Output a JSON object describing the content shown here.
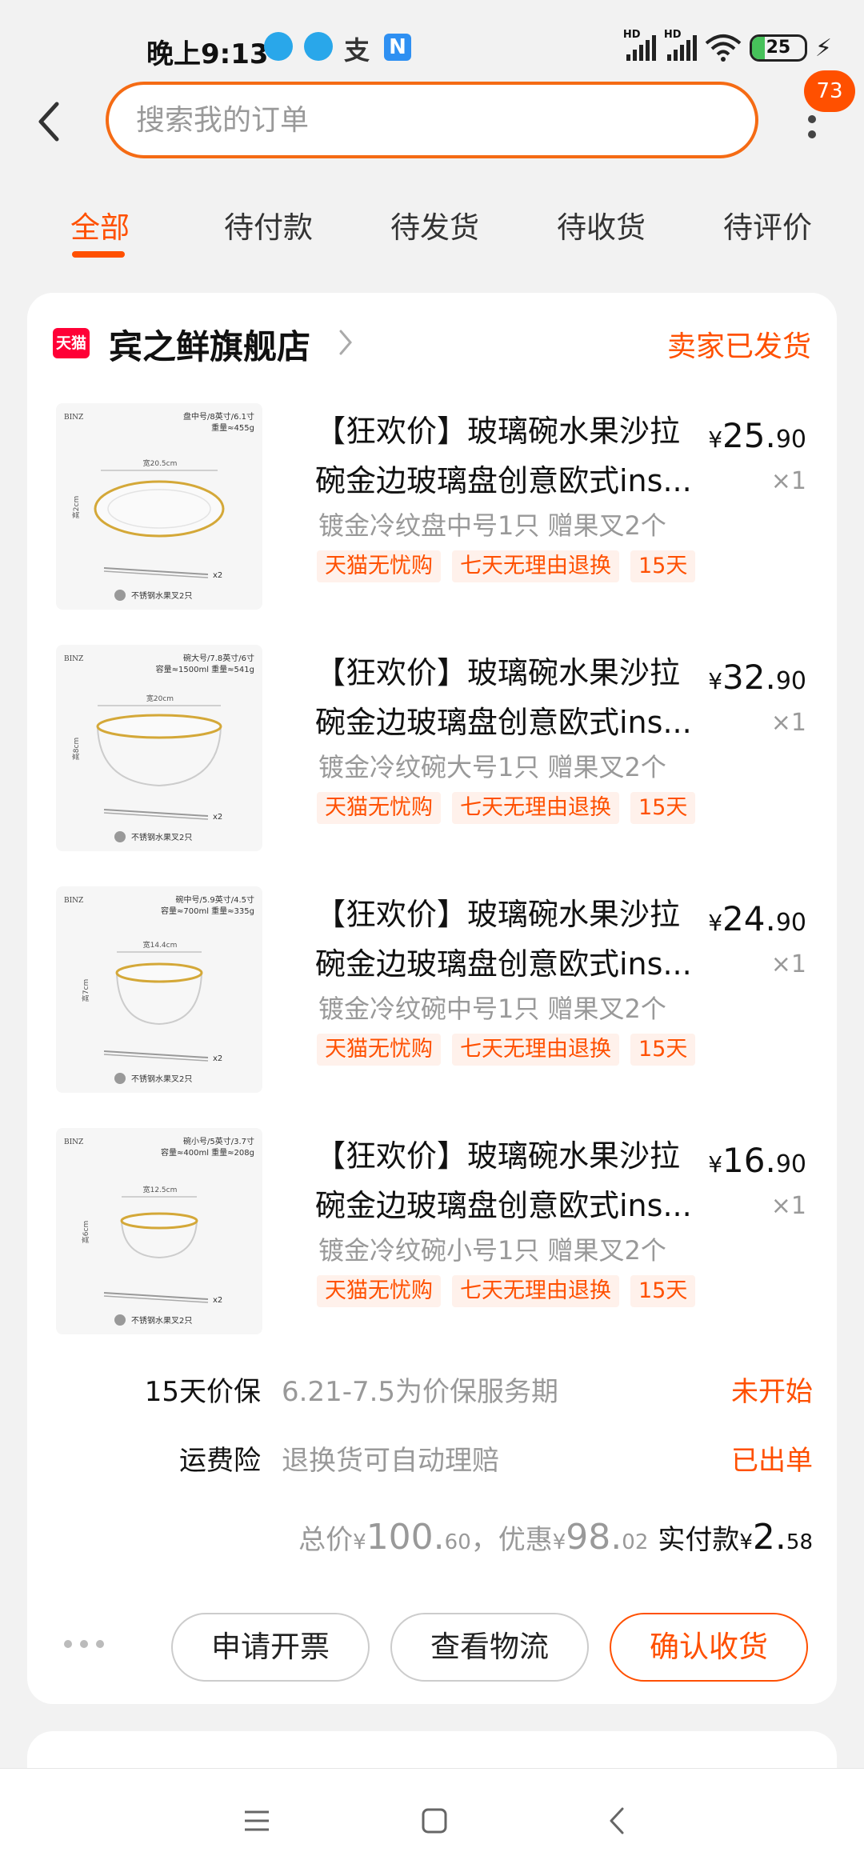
{
  "status_bar": {
    "time": "晚上9:13",
    "app_icons": [
      "qq-icon",
      "qq-icon",
      "alipay-icon",
      "n-app-icon"
    ],
    "zhi_glyph": "支",
    "n_glyph": "N",
    "signal_label": "HD",
    "battery_level": "25",
    "battery_fraction": 0.25
  },
  "header": {
    "search_placeholder": "搜索我的订单",
    "more_badge": "73"
  },
  "tabs": [
    {
      "label": "全部",
      "active": true
    },
    {
      "label": "待付款",
      "active": false
    },
    {
      "label": "待发货",
      "active": false
    },
    {
      "label": "待收货",
      "active": false
    },
    {
      "label": "待评价",
      "active": false
    }
  ],
  "order": {
    "shop_badge": "天猫",
    "shop_name": "宾之鲜旗舰店",
    "status": "卖家已发货",
    "items": [
      {
        "title_line1": "【狂欢价】玻璃碗水果沙拉",
        "title_line2": "碗金边玻璃盘创意欧式ins...",
        "sku": "镀金冷纹盘中号1只  赠果叉2个",
        "tags": [
          "天猫无忧购",
          "七天无理由退换",
          "15天"
        ],
        "price_currency": "¥",
        "price_int": "25.",
        "price_dec": "90",
        "qty": "×1",
        "thumb": {
          "brand": "BINZ",
          "size_line1": "盘中号/8英寸/6.1寸",
          "size_line2": "重量≈455g",
          "width": "宽20.5cm",
          "height": "高2cm",
          "fork": "x2",
          "caption": "不锈钢水果叉2只"
        }
      },
      {
        "title_line1": "【狂欢价】玻璃碗水果沙拉",
        "title_line2": "碗金边玻璃盘创意欧式ins...",
        "sku": "镀金冷纹碗大号1只  赠果叉2个",
        "tags": [
          "天猫无忧购",
          "七天无理由退换",
          "15天"
        ],
        "price_currency": "¥",
        "price_int": "32.",
        "price_dec": "90",
        "qty": "×1",
        "thumb": {
          "brand": "BINZ",
          "size_line1": "碗大号/7.8英寸/6寸",
          "size_line2": "容量≈1500ml 重量≈541g",
          "width": "宽20cm",
          "height": "高8cm",
          "fork": "x2",
          "caption": "不锈钢水果叉2只"
        }
      },
      {
        "title_line1": "【狂欢价】玻璃碗水果沙拉",
        "title_line2": "碗金边玻璃盘创意欧式ins...",
        "sku": "镀金冷纹碗中号1只  赠果叉2个",
        "tags": [
          "天猫无忧购",
          "七天无理由退换",
          "15天"
        ],
        "price_currency": "¥",
        "price_int": "24.",
        "price_dec": "90",
        "qty": "×1",
        "thumb": {
          "brand": "BINZ",
          "size_line1": "碗中号/5.9英寸/4.5寸",
          "size_line2": "容量≈700ml 重量≈335g",
          "width": "宽14.4cm",
          "height": "高7cm",
          "fork": "x2",
          "caption": "不锈钢水果叉2只"
        }
      },
      {
        "title_line1": "【狂欢价】玻璃碗水果沙拉",
        "title_line2": "碗金边玻璃盘创意欧式ins...",
        "sku": "镀金冷纹碗小号1只  赠果叉2个",
        "tags": [
          "天猫无忧购",
          "七天无理由退换",
          "15天"
        ],
        "price_currency": "¥",
        "price_int": "16.",
        "price_dec": "90",
        "qty": "×1",
        "thumb": {
          "brand": "BINZ",
          "size_line1": "碗小号/5英寸/3.7寸",
          "size_line2": "容量≈400ml 重量≈208g",
          "width": "宽12.5cm",
          "height": "高6cm",
          "fork": "x2",
          "caption": "不锈钢水果叉2只"
        }
      }
    ],
    "services": [
      {
        "label": "15天价保",
        "desc": "6.21-7.5为价保服务期",
        "status": "未开始"
      },
      {
        "label": "运费险",
        "desc": "退换货可自动理赔",
        "status": "已出单"
      }
    ],
    "totals": {
      "total_prefix": "总价",
      "total_cur": "¥",
      "total_int": "100.",
      "total_dec": "60",
      "sep": "，",
      "discount_prefix": "优惠",
      "discount_cur": "¥",
      "discount_int": "98.",
      "discount_dec": "02",
      "paid_prefix": "实付款",
      "paid_cur": "¥",
      "paid_int": "2.",
      "paid_dec": "58"
    },
    "actions": {
      "invoice": "申请开票",
      "logistics": "查看物流",
      "confirm": "确认收货"
    }
  },
  "colors": {
    "accent": "#ff5000",
    "search_border": "#f56b14",
    "tag_bg": "#fff1eb",
    "tmall_red": "#ff0036"
  },
  "nav_icons": [
    "menu-icon",
    "home-square-icon",
    "back-triangle-icon"
  ]
}
